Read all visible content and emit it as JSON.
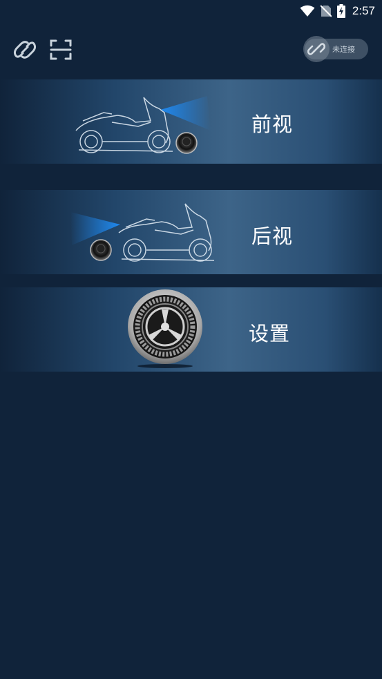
{
  "status_bar": {
    "time": "2:57",
    "icons": [
      "wifi-icon",
      "no-sim-icon",
      "battery-charging-icon"
    ]
  },
  "toolbar": {
    "left_icons": [
      "link-rings-icon",
      "scan-frame-icon"
    ],
    "connection": {
      "label": "未连接",
      "icon": "chain-link-icon"
    }
  },
  "menu": {
    "items": [
      {
        "id": "front",
        "label": "前视",
        "icon": "motorcycle-front-camera-icon"
      },
      {
        "id": "rear",
        "label": "后视",
        "icon": "motorcycle-rear-camera-icon"
      },
      {
        "id": "settings",
        "label": "设置",
        "icon": "gear-icon"
      }
    ]
  },
  "colors": {
    "background": "#10233a",
    "card_highlight": "#3d6488",
    "beam_blue": "#1e90ff"
  }
}
